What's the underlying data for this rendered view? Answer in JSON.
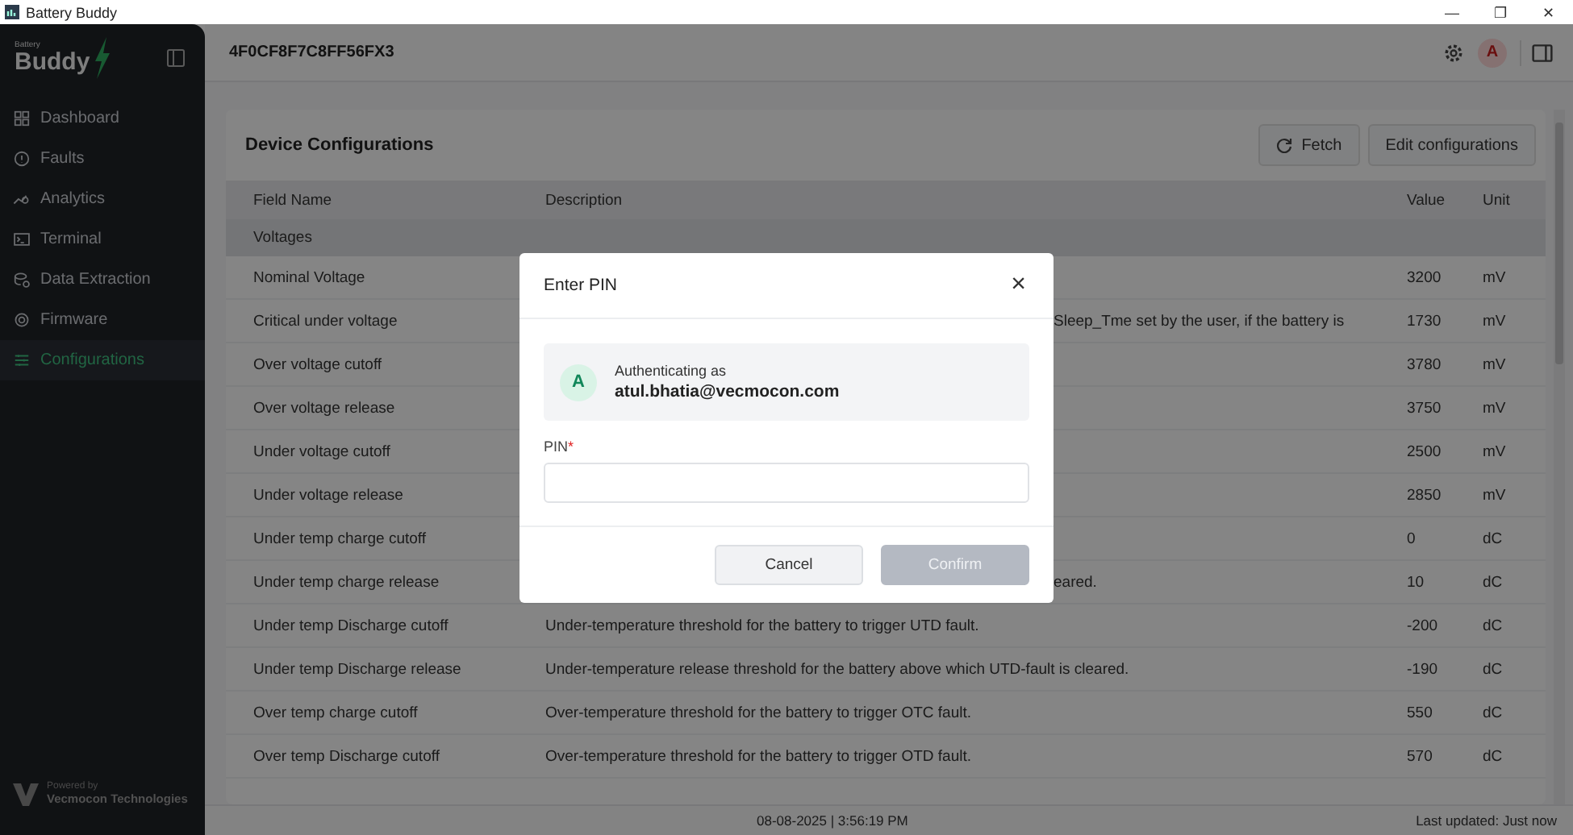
{
  "window": {
    "title": "Battery Buddy",
    "controls": [
      "—",
      "❐",
      "✕"
    ]
  },
  "sidebar": {
    "logo_small": "Battery",
    "logo": "Buddy",
    "items": [
      {
        "label": "Dashboard",
        "selected": false
      },
      {
        "label": "Faults",
        "selected": false
      },
      {
        "label": "Analytics",
        "selected": false
      },
      {
        "label": "Terminal",
        "selected": false
      },
      {
        "label": "Data Extraction",
        "selected": false
      },
      {
        "label": "Firmware",
        "selected": false
      },
      {
        "label": "Configurations",
        "selected": true
      }
    ],
    "powered_by": "Powered by",
    "company": "Vecmocon Technologies"
  },
  "header": {
    "device_id": "4F0CF8F7C8FF56FX3",
    "avatar": "A"
  },
  "card": {
    "title": "Device Configurations",
    "buttons": [
      "Fetch",
      "Edit configurations"
    ]
  },
  "table": {
    "columns": [
      "Field Name",
      "Description",
      "Value",
      "Unit"
    ],
    "group": "Voltages",
    "rows": [
      {
        "field": "Nominal Voltage",
        "value": "3200",
        "unit": "mV"
      },
      {
        "field": "Critical under voltage",
        "description": "Sleep_Tme set by the user, if the battery is",
        "partial": true,
        "value": "1730",
        "unit": "mV"
      },
      {
        "field": "Over voltage cutoff",
        "value": "3780",
        "unit": "mV"
      },
      {
        "field": "Over voltage release",
        "value": "3750",
        "unit": "mV"
      },
      {
        "field": "Under voltage cutoff",
        "value": "2500",
        "unit": "mV"
      },
      {
        "field": "Under voltage release",
        "value": "2850",
        "unit": "mV"
      },
      {
        "field": "Under temp charge cutoff",
        "value": "0",
        "unit": "dC"
      },
      {
        "field": "Under temp charge release",
        "description": "eared.",
        "partial": true,
        "value": "10",
        "unit": "dC"
      },
      {
        "field": "Under temp Discharge cutoff",
        "description": "Under-temperature threshold for the battery to trigger UTD fault.",
        "partial": false,
        "value": "-200",
        "unit": "dC"
      },
      {
        "field": "Under temp Discharge release",
        "description": "Under-temperature release threshold for the battery above which UTD-fault is cleared.",
        "partial": false,
        "value": "-190",
        "unit": "dC"
      },
      {
        "field": "Over temp charge cutoff",
        "description": "Over-temperature threshold for the battery to trigger OTC fault.",
        "partial": false,
        "value": "550",
        "unit": "dC"
      },
      {
        "field": "Over temp Discharge cutoff",
        "description": "Over-temperature threshold for the battery to trigger OTD fault.",
        "partial": false,
        "value": "570",
        "unit": "dC"
      }
    ]
  },
  "footer": {
    "datetime": "08-08-2025 | 3:56:19 PM",
    "last_updated": "Last updated: Just now"
  },
  "dialog": {
    "title": "Enter PIN",
    "close": "×",
    "avatar": "A",
    "auth_label": "Authenticating as",
    "email": "atul.bhatia@vecmocon.com",
    "field_label": "PIN",
    "required": "*",
    "buttons": [
      {
        "label": "Cancel",
        "disabled": false
      },
      {
        "label": "Confirm",
        "disabled": true
      }
    ]
  }
}
